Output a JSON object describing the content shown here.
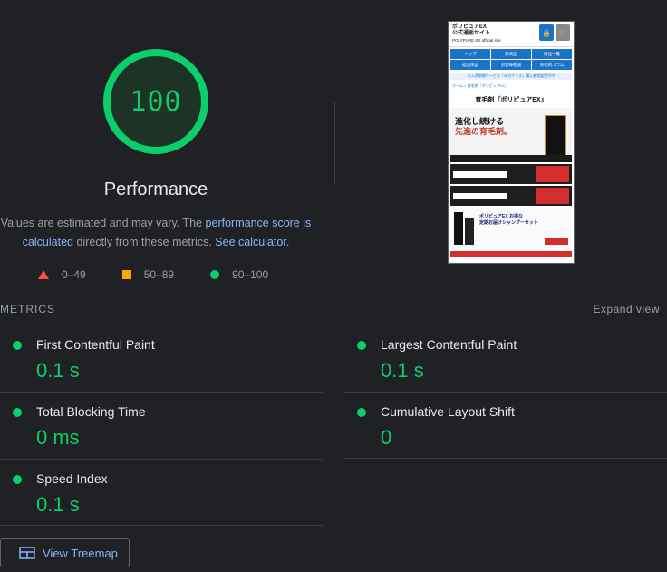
{
  "score": {
    "value": "100",
    "title": "Performance",
    "color": "#0cce6b",
    "fraction": 1.0
  },
  "description": {
    "part1": "Values are estimated and may vary. The ",
    "link1": "performance score is calculated",
    "part2": " directly from these metrics. ",
    "link2": "See calculator."
  },
  "legend": [
    {
      "range": "0–49",
      "icon": "triangle-icon",
      "color": "#ff4e42"
    },
    {
      "range": "50–89",
      "icon": "square-icon",
      "color": "#ffa400"
    },
    {
      "range": "90–100",
      "icon": "circle-icon",
      "color": "#0cce6b"
    }
  ],
  "thumbnail": {
    "brand": "ポリピュアEX",
    "brand_sub": "公式通販サイト",
    "brand_en": "POLYPURE EX official site",
    "nav": [
      "トップ",
      "新商品",
      "商品一覧",
      "返品保証",
      "お客様相談",
      "育毛剤コラム"
    ],
    "strip": "未入荷期間サービス「30分ナイス」購入者相談受付中",
    "crumb": "ホーム > 育毛剤「ポリピュアEX」",
    "page_title": "育毛剤『ポリピュアEX』",
    "hero_line1": "進化し続ける",
    "hero_line2": "先進の育毛剤。",
    "set_line1": "ポリピュアEX お得な",
    "set_line2": "定期お届けシャンプーセット"
  },
  "metrics": {
    "heading": "METRICS",
    "expand_label": "Expand view",
    "items": [
      {
        "name": "First Contentful Paint",
        "value": "0.1 s"
      },
      {
        "name": "Largest Contentful Paint",
        "value": "0.1 s"
      },
      {
        "name": "Total Blocking Time",
        "value": "0 ms"
      },
      {
        "name": "Cumulative Layout Shift",
        "value": "0"
      },
      {
        "name": "Speed Index",
        "value": "0.1 s"
      }
    ]
  },
  "treemap": {
    "label": "View Treemap",
    "icon": "treemap-icon"
  }
}
